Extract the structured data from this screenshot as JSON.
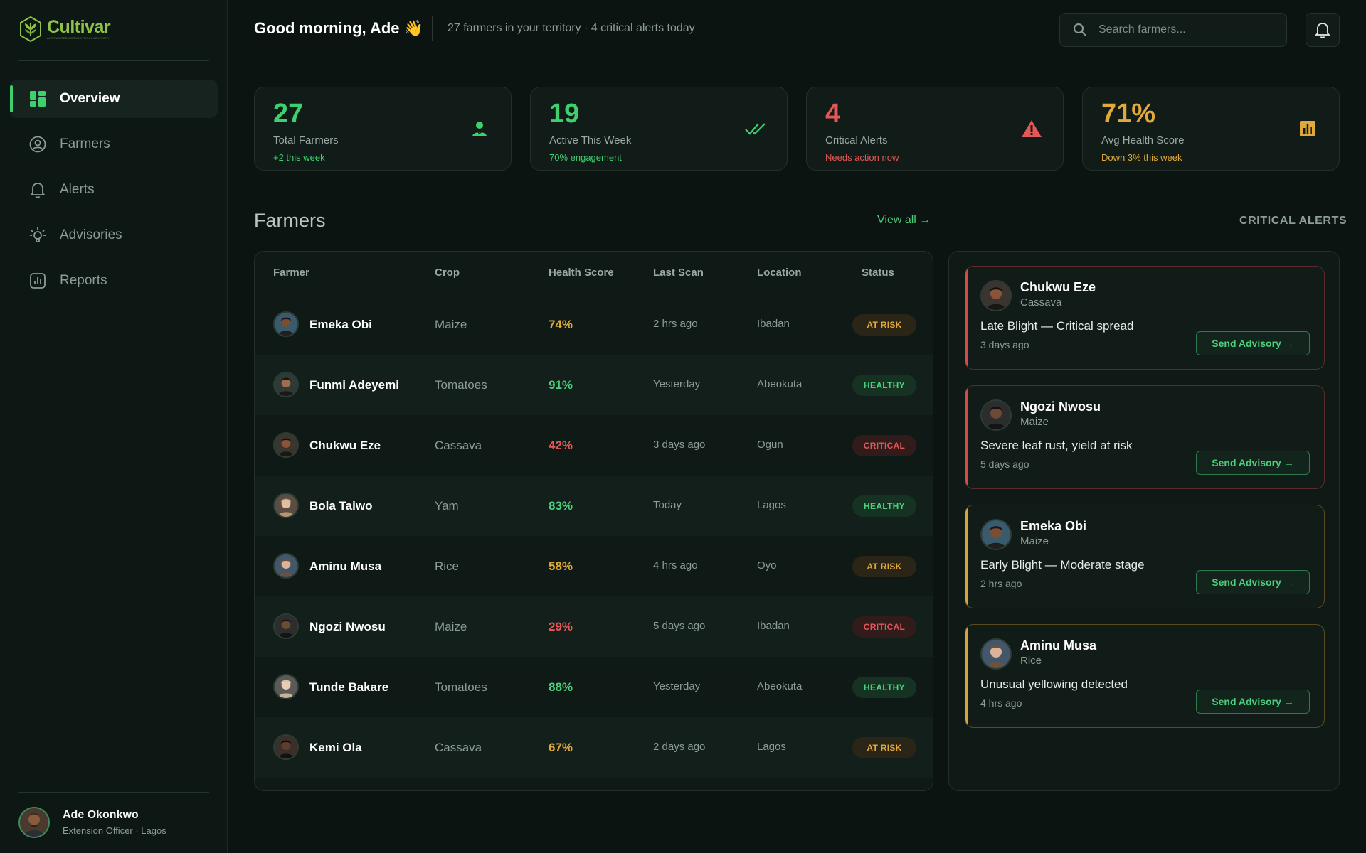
{
  "brand": {
    "name": "Cultivar",
    "tagline": "AI-POWERED AGRICULTURAL ADVISORY"
  },
  "nav": [
    {
      "label": "Overview",
      "icon": "grid-icon",
      "active": true
    },
    {
      "label": "Farmers",
      "icon": "user-circle-icon",
      "active": false
    },
    {
      "label": "Alerts",
      "icon": "bell-icon",
      "active": false
    },
    {
      "label": "Advisories",
      "icon": "lightbulb-icon",
      "active": false
    },
    {
      "label": "Reports",
      "icon": "bar-chart-icon",
      "active": false
    }
  ],
  "user": {
    "name": "Ade Okonkwo",
    "role": "Extension Officer · Lagos"
  },
  "header": {
    "greeting": "Good morning, Ade 👋",
    "subtitle": "27 farmers in your territory · 4 critical alerts today",
    "search_placeholder": "Search farmers..."
  },
  "stats": [
    {
      "value": "27",
      "label": "Total Farmers",
      "note": "+2 this week",
      "color": "#3ecf6e",
      "note_color": "#3ecf6e",
      "icon": "person-icon"
    },
    {
      "value": "19",
      "label": "Active This Week",
      "note": "70% engagement",
      "color": "#3ecf6e",
      "note_color": "#3ecf6e",
      "icon": "double-check-icon"
    },
    {
      "value": "4",
      "label": "Critical Alerts",
      "note": "Needs action now",
      "color": "#e25757",
      "note_color": "#e25757",
      "icon": "warning-icon"
    },
    {
      "value": "71%",
      "label": "Avg Health Score",
      "note": "Down 3% this week",
      "color": "#e0a93a",
      "note_color": "#e0a93a",
      "icon": "chart-square-icon"
    }
  ],
  "farmers_section": {
    "title": "Farmers",
    "view_all": "View all →"
  },
  "alerts_section": {
    "title": "CRITICAL ALERTS"
  },
  "table": {
    "columns": [
      "Farmer",
      "Crop",
      "Health Score",
      "Last Scan",
      "Location",
      "Status"
    ],
    "rows": [
      {
        "name": "Emeka Obi",
        "crop": "Maize",
        "score": "74%",
        "score_color": "#e0a93a",
        "last_scan": "2 hrs ago",
        "location": "Ibadan",
        "status": "AT RISK",
        "status_kind": "risk"
      },
      {
        "name": "Funmi Adeyemi",
        "crop": "Tomatoes",
        "score": "91%",
        "score_color": "#4cd07d",
        "last_scan": "Yesterday",
        "location": "Abeokuta",
        "status": "HEALTHY",
        "status_kind": "healthy"
      },
      {
        "name": "Chukwu Eze",
        "crop": "Cassava",
        "score": "42%",
        "score_color": "#e25757",
        "last_scan": "3 days ago",
        "location": "Ogun",
        "status": "CRITICAL",
        "status_kind": "critical"
      },
      {
        "name": "Bola Taiwo",
        "crop": "Yam",
        "score": "83%",
        "score_color": "#4cd07d",
        "last_scan": "Today",
        "location": "Lagos",
        "status": "HEALTHY",
        "status_kind": "healthy"
      },
      {
        "name": "Aminu Musa",
        "crop": "Rice",
        "score": "58%",
        "score_color": "#e0a93a",
        "last_scan": "4 hrs ago",
        "location": "Oyo",
        "status": "AT RISK",
        "status_kind": "risk"
      },
      {
        "name": "Ngozi Nwosu",
        "crop": "Maize",
        "score": "29%",
        "score_color": "#e25757",
        "last_scan": "5 days ago",
        "location": "Ibadan",
        "status": "CRITICAL",
        "status_kind": "critical"
      },
      {
        "name": "Tunde Bakare",
        "crop": "Tomatoes",
        "score": "88%",
        "score_color": "#4cd07d",
        "last_scan": "Yesterday",
        "location": "Abeokuta",
        "status": "HEALTHY",
        "status_kind": "healthy"
      },
      {
        "name": "Kemi Ola",
        "crop": "Cassava",
        "score": "67%",
        "score_color": "#e0a93a",
        "last_scan": "2 days ago",
        "location": "Lagos",
        "status": "AT RISK",
        "status_kind": "risk"
      }
    ]
  },
  "alerts": [
    {
      "name": "Chukwu Eze",
      "crop": "Cassava",
      "issue": "Late Blight — Critical spread",
      "time": "3 days ago",
      "severity": "crit",
      "button": "Send Advisory →"
    },
    {
      "name": "Ngozi Nwosu",
      "crop": "Maize",
      "issue": "Severe leaf rust, yield at risk",
      "time": "5 days ago",
      "severity": "crit",
      "button": "Send Advisory →"
    },
    {
      "name": "Emeka Obi",
      "crop": "Maize",
      "issue": "Early Blight — Moderate stage",
      "time": "2 hrs ago",
      "severity": "warn",
      "button": "Send Advisory →"
    },
    {
      "name": "Aminu Musa",
      "crop": "Rice",
      "issue": "Unusual yellowing detected",
      "time": "4 hrs ago",
      "severity": "warn",
      "button": "Send Advisory →"
    }
  ]
}
